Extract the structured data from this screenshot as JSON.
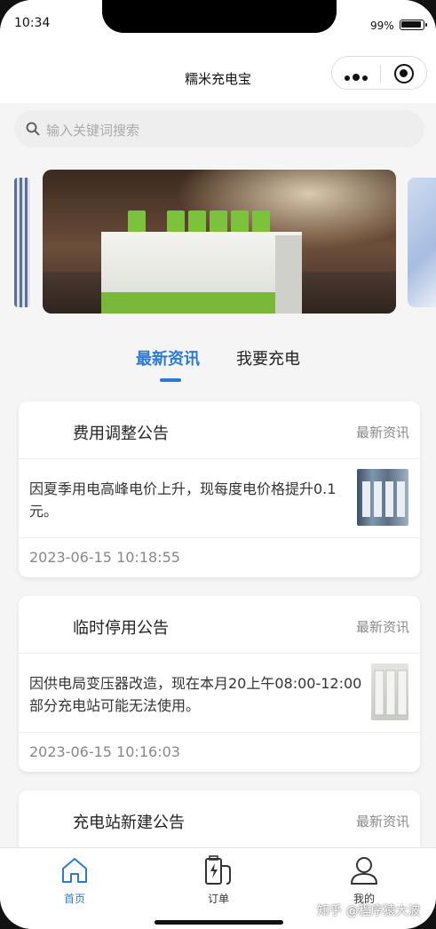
{
  "status": {
    "time": "10:34",
    "battery": "99%"
  },
  "nav": {
    "title": "糯米充电宝"
  },
  "search": {
    "placeholder": "输入关键词搜索"
  },
  "tabs": [
    {
      "label": "最新资讯",
      "active": true
    },
    {
      "label": "我要充电",
      "active": false
    }
  ],
  "news": [
    {
      "title": "费用调整公告",
      "category": "最新资讯",
      "body": "因夏季用电高峰电价上升，现每度电价格提升0.1元。",
      "date": "2023-06-15 10:18:55"
    },
    {
      "title": "临时停用公告",
      "category": "最新资讯",
      "body": "因供电局变压器改造，现在本月20上午08:00-12:00部分充电站可能无法使用。",
      "date": "2023-06-15 10:16:03"
    },
    {
      "title": "充电站新建公告",
      "category": "最新资讯"
    }
  ],
  "tabbar": [
    {
      "label": "首页",
      "icon": "home-icon",
      "active": true
    },
    {
      "label": "订单",
      "icon": "charging-order-icon",
      "active": false
    },
    {
      "label": "我的",
      "icon": "user-icon",
      "active": false
    }
  ],
  "watermark": "知乎 @程序猿大波",
  "colors": {
    "accent": "#2d7ad6",
    "text": "#222222",
    "muted": "#888888"
  }
}
